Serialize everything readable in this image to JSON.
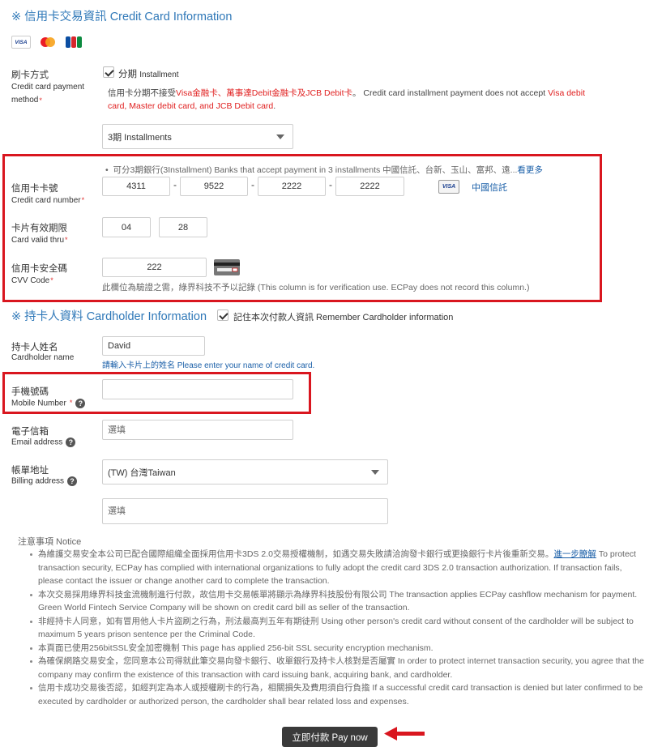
{
  "credit_section": {
    "title": "※ 信用卡交易資訊 Credit Card Information",
    "logos": [
      "VISA",
      "MasterCard",
      "JCB"
    ]
  },
  "payment_method": {
    "label_zh": "刷卡方式",
    "label_en": "Credit card payment method",
    "option_label": "分期",
    "option_label_en": "Installment",
    "note_prefix": "信用卡分期不接受",
    "note_red1": "Visa金融卡、萬事達Debit金融卡及JCB Debit卡",
    "note_mid": "。 Credit card installment payment does not accept ",
    "note_red2": "Visa debit card, Master debit card, and JCB Debit card",
    "note_end": ".",
    "selected": "3期 Installments"
  },
  "banks_note": {
    "text": "可分3期銀行(3Installment) Banks that accept payment in 3 installments 中國信託、台新、玉山、富邦、遠...",
    "more": "看更多"
  },
  "card_number": {
    "label_zh": "信用卡卡號",
    "label_en": "Credit card number",
    "parts": [
      "4311",
      "9522",
      "2222",
      "2222"
    ],
    "bank": "中國信託",
    "brand_icon": "VISA"
  },
  "valid_thru": {
    "label_zh": "卡片有效期限",
    "label_en": "Card valid thru",
    "month": "04",
    "year": "28"
  },
  "cvv": {
    "label_zh": "信用卡安全碼",
    "label_en": "CVV Code",
    "value": "222",
    "note": "此欄位為驗證之需，綠界科技不予以記錄 (This column is for verification use. ECPay does not record this column.)"
  },
  "cardholder_section": {
    "title": "※ 持卡人資料 Cardholder Information",
    "remember": "記住本次付款人資訊 Remember Cardholder information"
  },
  "cardholder_name": {
    "label_zh": "持卡人姓名",
    "label_en": "Cardholder name",
    "value": "David",
    "hint": "請輸入卡片上的姓名 Please enter your name of credit card."
  },
  "mobile": {
    "label_zh": "手機號碼",
    "label_en": "Mobile Number",
    "value": ""
  },
  "email": {
    "label_zh": "電子信箱",
    "label_en": "Email address",
    "placeholder": "選填"
  },
  "billing": {
    "label_zh": "帳單地址",
    "label_en": "Billing address",
    "country": "(TW) 台灣Taiwan",
    "placeholder": "選填"
  },
  "notice": {
    "title": "注意事項 Notice",
    "items": [
      {
        "text": "為維護交易安全本公司已配合國際組織全面採用信用卡3DS 2.0交易授權機制，如遇交易失敗請洽詢發卡銀行或更換銀行卡片後重新交易。",
        "link": "進一步瞭解",
        "text2": " To protect transaction security, ECPay has complied with international organizations to fully adopt the credit card 3DS 2.0 transaction authorization. If transaction fails, please contact the issuer or change another card to complete the transaction."
      },
      {
        "text": "本次交易採用綠界科技金流機制進行付款，故信用卡交易帳單將顯示為綠界科技股份有限公司 The transaction applies ECPay cashflow mechanism for payment. Green World Fintech Service Company will be shown on credit card bill as seller of the transaction."
      },
      {
        "text": "非經持卡人同意，如有冒用他人卡片盜刷之行為，刑法最高判五年有期徒刑 Using other person's credit card without consent of the cardholder will be subject to maximum 5 years prison sentence per the Criminal Code."
      },
      {
        "text": "本頁面已使用256bitSSL安全加密機制 This page has applied 256-bit SSL security encryption mechanism."
      },
      {
        "text": "為確保網路交易安全，您同意本公司得就此筆交易向發卡銀行、收單銀行及持卡人核對是否屬實 In order to protect internet transaction security, you agree that the company may confirm the existence of this transaction with card issuing bank, acquiring bank, and cardholder."
      },
      {
        "text": "信用卡成功交易後否認，如經判定為本人或授權刷卡的行為，相關損失及費用須自行負擔 If a successful credit card transaction is denied but later confirmed to be executed by cardholder or authorized person, the cardholder shall bear related loss and expenses."
      }
    ]
  },
  "pay_button": "立即付款 Pay now",
  "colors": {
    "accent_blue": "#2f78b8",
    "highlight_red": "#d9161f",
    "button_dark": "#3a3a3a"
  }
}
